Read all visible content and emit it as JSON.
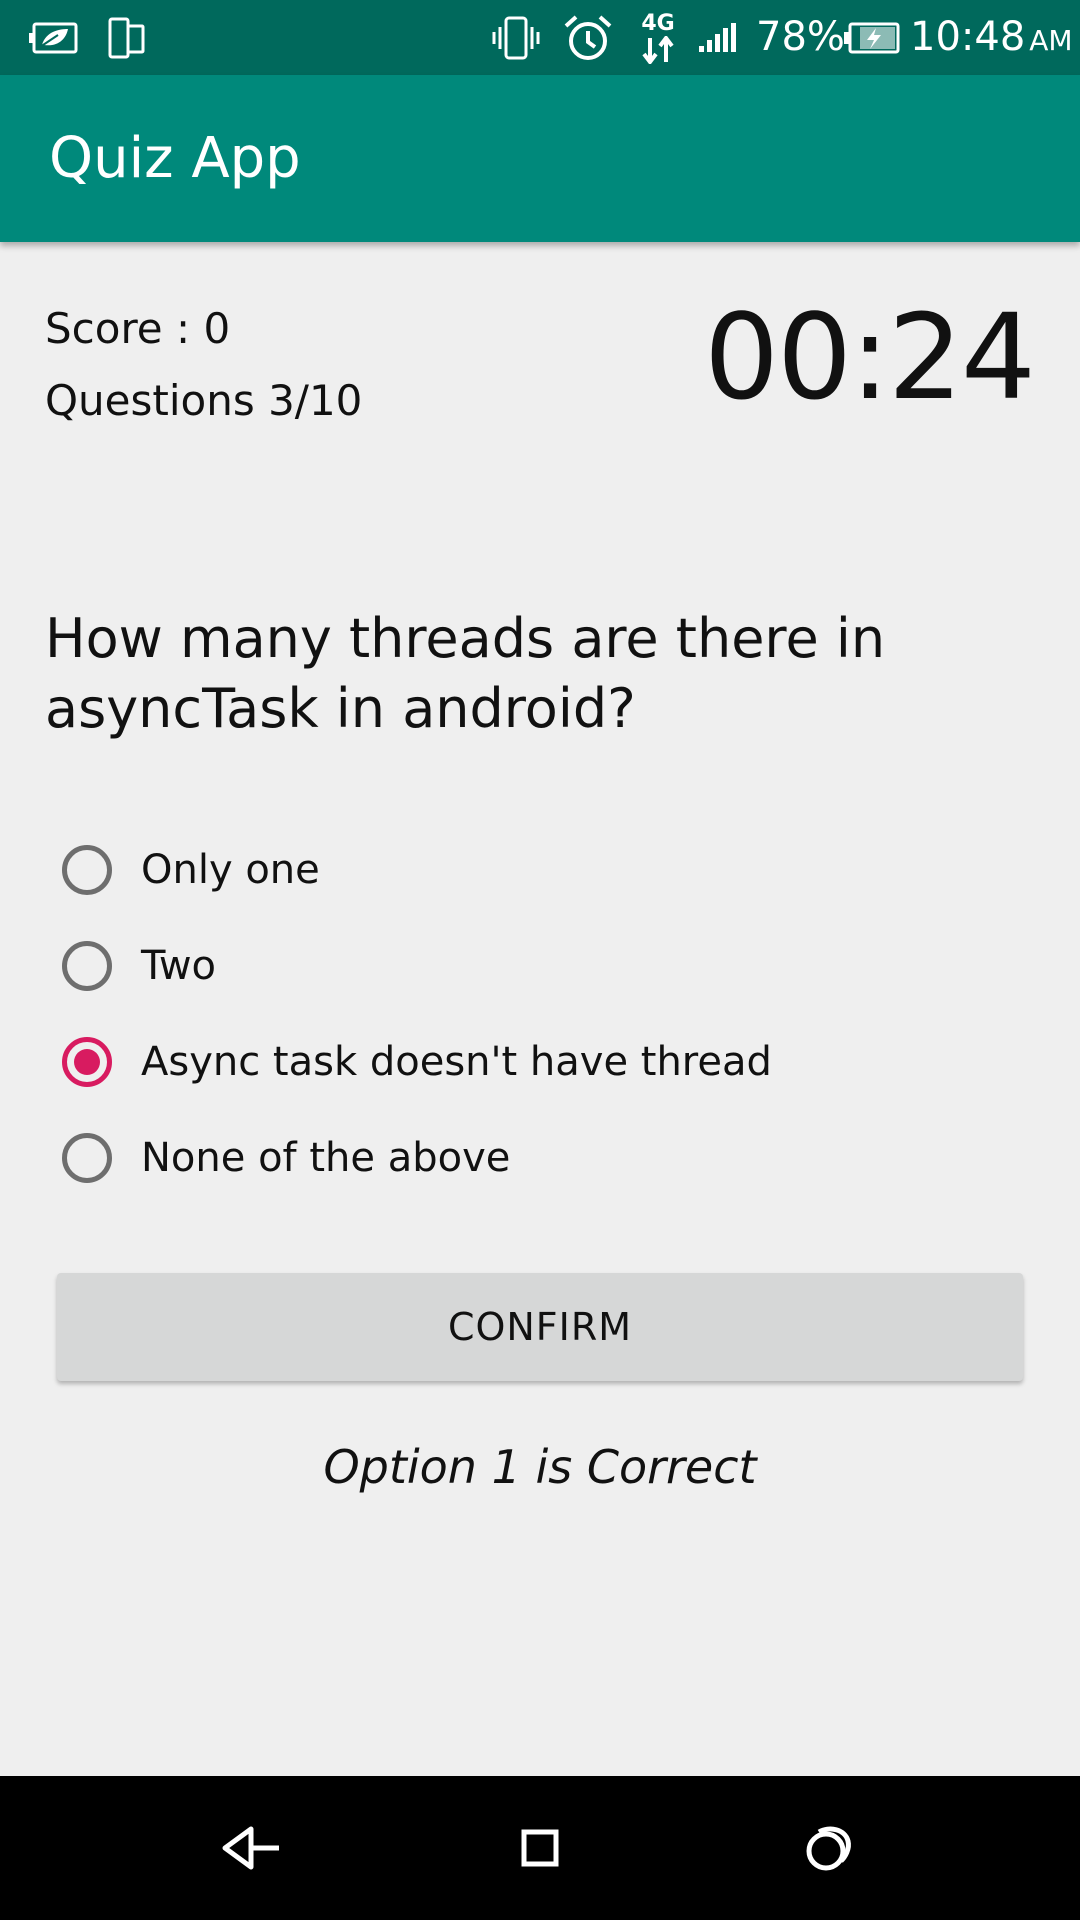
{
  "status_bar": {
    "battery_percent": "78%",
    "time": "10:48",
    "ampm": "AM",
    "network": "4G",
    "icons": [
      "leaf-battery-saver-icon",
      "phone-mirror-icon",
      "vibrate-icon",
      "alarm-icon",
      "network-4g-icon",
      "signal-icon",
      "battery-charging-icon"
    ]
  },
  "app_bar": {
    "title": "Quiz App"
  },
  "quiz": {
    "score_text": "Score : 0",
    "question_count_text": "Questions 3/10",
    "timer": "00:24",
    "question": "How many threads are there in asyncTask in android?",
    "options": [
      {
        "label": "Only one"
      },
      {
        "label": "Two"
      },
      {
        "label": "Async task doesn't have thread"
      },
      {
        "label": "None of the above"
      }
    ],
    "selected_option_index": 2,
    "confirm_label": "CONFIRM",
    "feedback": "Option 1 is Correct"
  },
  "nav_bar": {
    "icons": [
      "back-icon",
      "home-icon",
      "recents-icon"
    ]
  },
  "colors": {
    "status_bar": "#00695c",
    "app_bar": "#00897b",
    "accent": "#d81b60",
    "background": "#efefef",
    "button": "#d6d7d7"
  }
}
